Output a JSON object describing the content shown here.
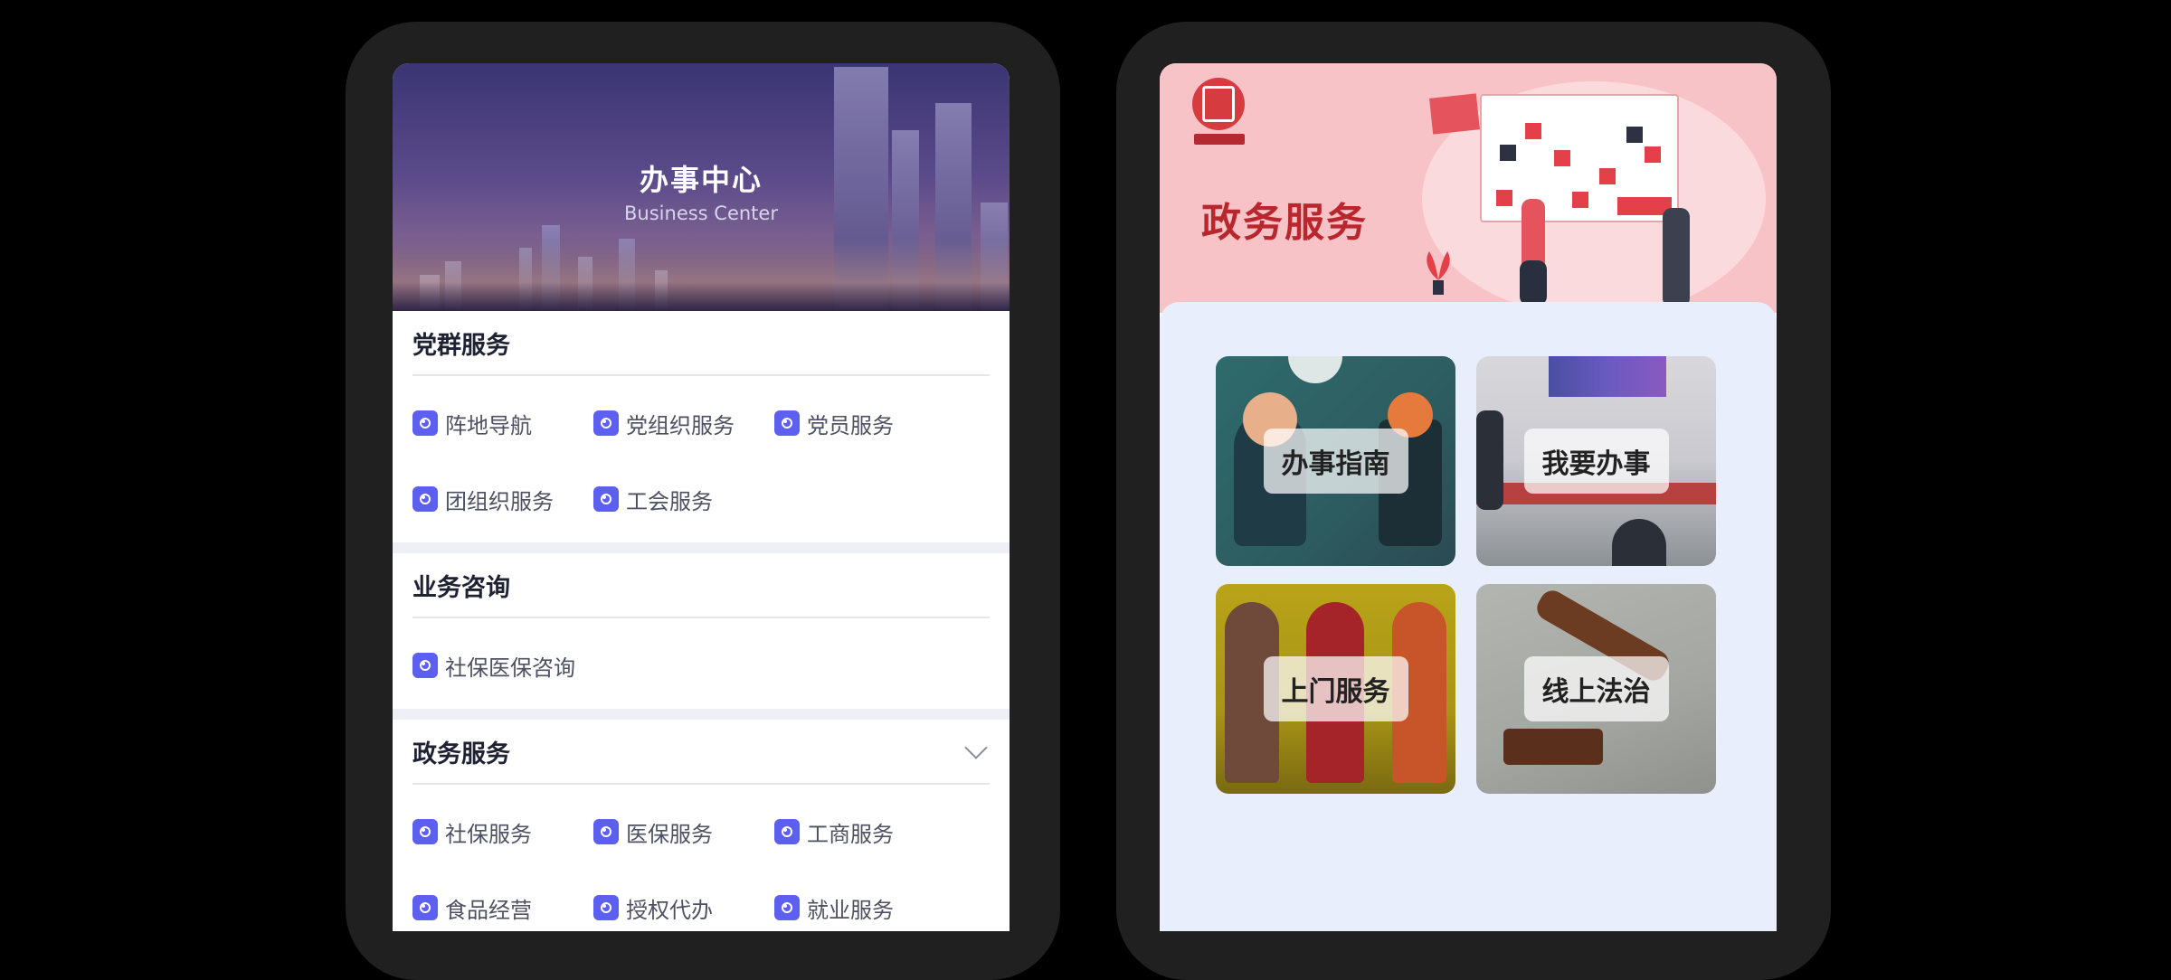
{
  "left_screen": {
    "hero": {
      "title": "办事中心",
      "subtitle": "Business Center"
    },
    "sections": [
      {
        "title": "党群服务",
        "items": [
          "阵地导航",
          "党组织服务",
          "党员服务",
          "团组织服务",
          "工会服务"
        ]
      },
      {
        "title": "业务咨询",
        "items": [
          "社保医保咨询"
        ]
      },
      {
        "title": "政务服务",
        "items": [
          "社保服务",
          "医保服务",
          "工商服务",
          "食品经营",
          "授权代办",
          "就业服务"
        ]
      }
    ]
  },
  "right_screen": {
    "title": "政务服务",
    "tiles": [
      "办事指南",
      "我要办事",
      "上门服务",
      "线上法治"
    ]
  },
  "colors": {
    "accent_icon": "#5c5ff0",
    "right_title": "#b8272e",
    "right_hero_bg": "#f8c3c7",
    "panel_bg": "#e9eefc"
  }
}
